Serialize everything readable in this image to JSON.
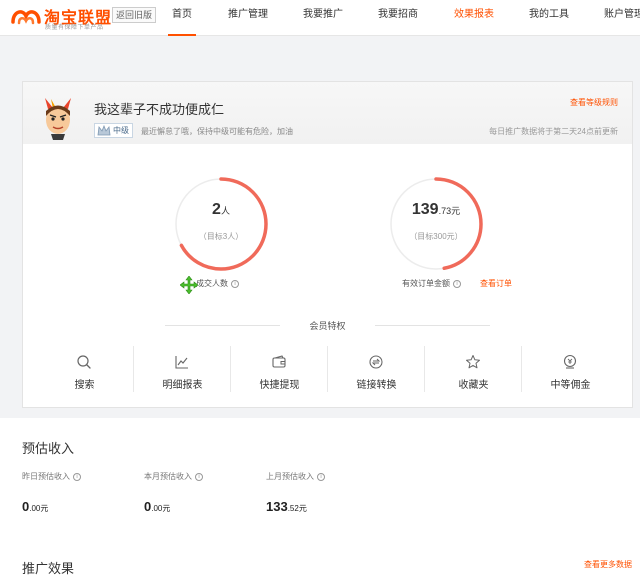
{
  "nav": {
    "logo_text": "淘宝联盟",
    "logo_sub": "质量有保障下单产品",
    "old_version": "返回旧版",
    "items": [
      {
        "label": "首页"
      },
      {
        "label": "推广管理"
      },
      {
        "label": "我要推广"
      },
      {
        "label": "我要招商"
      },
      {
        "label": "效果报表"
      },
      {
        "label": "我的工具"
      },
      {
        "label": "账户管理"
      }
    ]
  },
  "profile": {
    "username": "我这辈子不成功便成仁",
    "level": "中级",
    "level_tip": "最近懈怠了哦，保持中级可能有危险，加油",
    "rule_link": "查看等级规则",
    "update_tip": "每日推广数据将于第二天24点前更新"
  },
  "stats": {
    "deals": {
      "value": "2",
      "unit": "人",
      "target": "（目标3人）",
      "label": "成交人数",
      "progress": 0.67
    },
    "orders": {
      "value_int": "139",
      "value_dec": ".73",
      "unit": "元",
      "target": "（目标300元）",
      "label": "有效订单金额",
      "link": "查看订单",
      "progress": 0.47
    }
  },
  "privileges": {
    "title": "会员特权",
    "items": [
      {
        "label": "搜索",
        "icon": "search-icon"
      },
      {
        "label": "明细报表",
        "icon": "chart-icon"
      },
      {
        "label": "快捷提现",
        "icon": "wallet-icon"
      },
      {
        "label": "链接转换",
        "icon": "link-convert-icon"
      },
      {
        "label": "收藏夹",
        "icon": "star-icon"
      },
      {
        "label": "中等佣金",
        "icon": "commission-icon"
      }
    ]
  },
  "income": {
    "title": "预估收入",
    "items": [
      {
        "label": "昨日预估收入",
        "value_int": "0",
        "value_dec": ".00",
        "unit": "元"
      },
      {
        "label": "本月预估收入",
        "value_int": "0",
        "value_dec": ".00",
        "unit": "元"
      },
      {
        "label": "上月预估收入",
        "value_int": "133",
        "value_dec": ".52",
        "unit": "元"
      }
    ]
  },
  "effect": {
    "title": "推广效果",
    "more_link": "查看更多数据"
  },
  "colors": {
    "accent": "#ff5000",
    "ring": "#f06a5a",
    "ring_track": "#ececec"
  }
}
